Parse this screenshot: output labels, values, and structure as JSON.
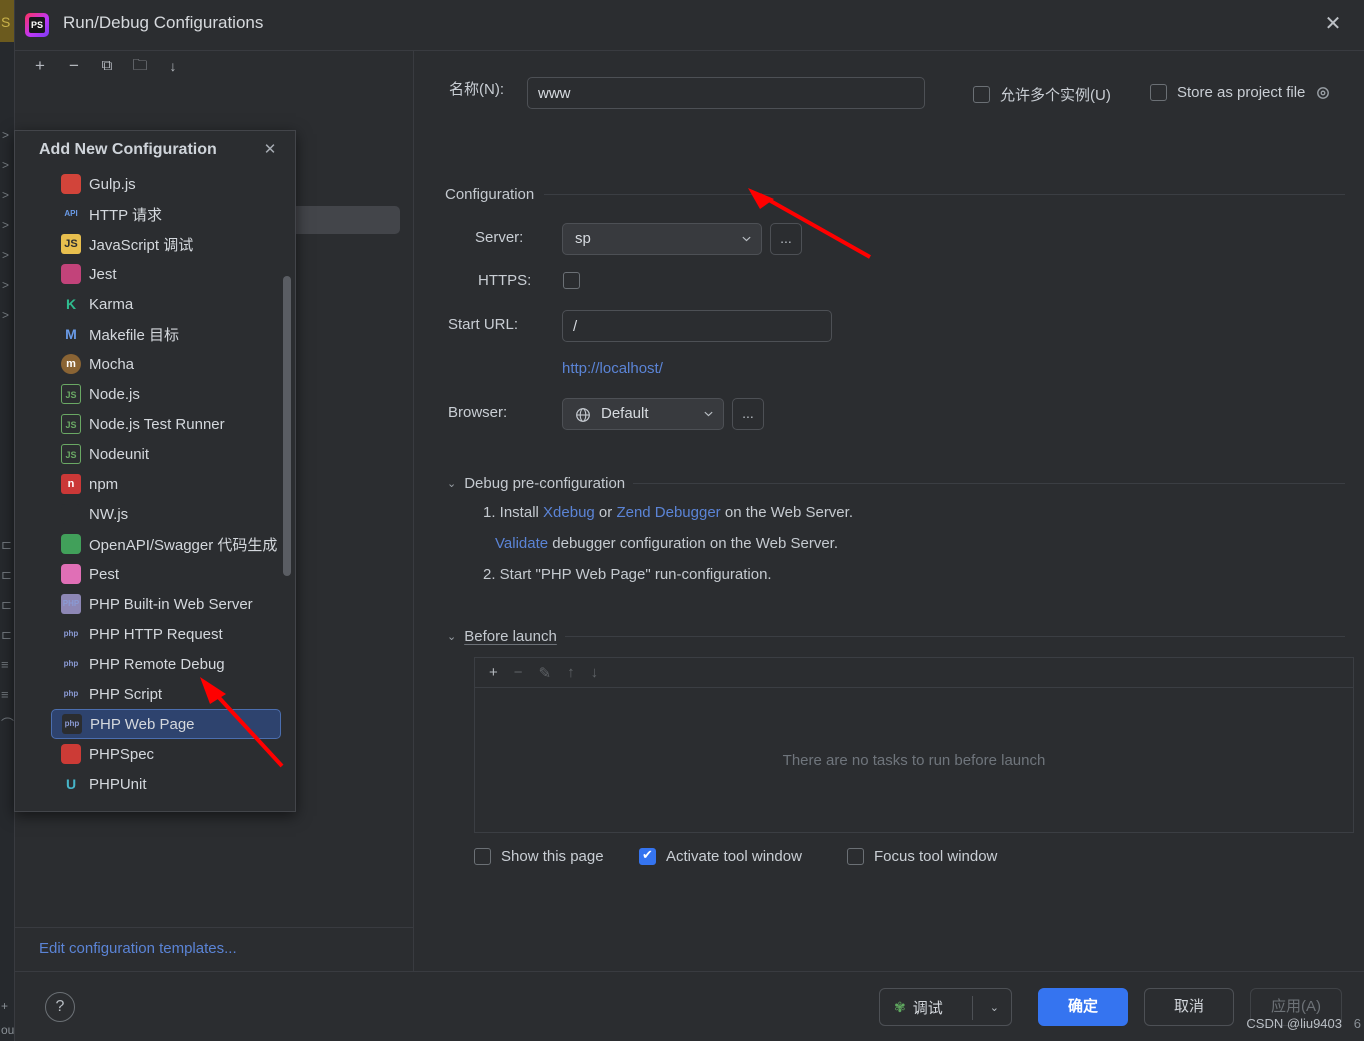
{
  "window": {
    "title": "Run/Debug Configurations",
    "app_icon": "phpstorm-icon",
    "close_label": "✕",
    "accent": "#3574f0"
  },
  "left_toolbar": {
    "add_label": "+",
    "remove_label": "−",
    "copy_label": "⧉",
    "folder_label": "🗀",
    "sort_label": "↓"
  },
  "popup": {
    "title": "Add New Configuration",
    "close_label": "✕",
    "items": [
      {
        "label": "Gulp.js",
        "icon": "gulp-icon",
        "glyph": "",
        "bg": "#d2443a",
        "selected": false
      },
      {
        "label": "HTTP 请求",
        "icon": "http-request-icon",
        "glyph": "API",
        "bg": "#2b2d30",
        "selected": false
      },
      {
        "label": "JavaScript 调试",
        "icon": "javascript-icon",
        "glyph": "JS",
        "bg": "#e8bf4e",
        "selected": false
      },
      {
        "label": "Jest",
        "icon": "jest-icon",
        "glyph": "",
        "bg": "#c2437a",
        "selected": false
      },
      {
        "label": "Karma",
        "icon": "karma-icon",
        "glyph": "K",
        "bg": "#2b2d30",
        "selected": false
      },
      {
        "label": "Makefile 目标",
        "icon": "makefile-icon",
        "glyph": "M",
        "bg": "#2b2d30",
        "selected": false
      },
      {
        "label": "Mocha",
        "icon": "mocha-icon",
        "glyph": "m",
        "bg": "#8a6434",
        "selected": false
      },
      {
        "label": "Node.js",
        "icon": "nodejs-icon",
        "glyph": "JS",
        "bg": "#2b2d30",
        "selected": false
      },
      {
        "label": "Node.js Test Runner",
        "icon": "nodejs-test-runner-icon",
        "glyph": "JS",
        "bg": "#2b2d30",
        "selected": false
      },
      {
        "label": "Nodeunit",
        "icon": "nodeunit-icon",
        "glyph": "JS",
        "bg": "#2b2d30",
        "selected": false
      },
      {
        "label": "npm",
        "icon": "npm-icon",
        "glyph": "n",
        "bg": "#cb3837",
        "selected": false
      },
      {
        "label": "NW.js",
        "icon": "nwjs-icon",
        "glyph": "",
        "bg": "#2b2d30",
        "selected": false
      },
      {
        "label": "OpenAPI/Swagger 代码生成",
        "icon": "openapi-swagger-icon",
        "glyph": "",
        "bg": "#41a05a",
        "selected": false
      },
      {
        "label": "Pest",
        "icon": "pest-icon",
        "glyph": "",
        "bg": "#e06fb6",
        "selected": false
      },
      {
        "label": "PHP Built-in Web Server",
        "icon": "php-builtin-server-icon",
        "glyph": "PHP",
        "bg": "#8d87b5",
        "selected": false
      },
      {
        "label": "PHP HTTP Request",
        "icon": "php-http-request-icon",
        "glyph": "php",
        "bg": "#2b2d30",
        "selected": false
      },
      {
        "label": "PHP Remote Debug",
        "icon": "php-remote-debug-icon",
        "glyph": "php",
        "bg": "#2b2d30",
        "selected": false
      },
      {
        "label": "PHP Script",
        "icon": "php-script-icon",
        "glyph": "php",
        "bg": "#2b2d30",
        "selected": false
      },
      {
        "label": "PHP Web Page",
        "icon": "php-web-page-icon",
        "glyph": "php",
        "bg": "#2b2d30",
        "selected": true
      },
      {
        "label": "PHPSpec",
        "icon": "phpspec-icon",
        "glyph": "",
        "bg": "#cc3b36",
        "selected": false
      },
      {
        "label": "PHPUnit",
        "icon": "phpunit-icon",
        "glyph": "U",
        "bg": "#2b2d30",
        "selected": false
      }
    ]
  },
  "left_footer": {
    "edit_templates_label": "Edit configuration templates..."
  },
  "form": {
    "name_label": "名称(N):",
    "name_value": "www",
    "name_placeholder": "",
    "allow_multiple_label": "允许多个实例(U)",
    "allow_multiple_checked": false,
    "store_as_project_file_label": "Store as project file",
    "store_as_project_file_checked": false,
    "gear_icon": "gear-icon",
    "configuration_group_label": "Configuration",
    "server_label": "Server:",
    "server_value": "sp",
    "server_dots_label": "...",
    "https_label": "HTTPS:",
    "https_checked": false,
    "start_url_label": "Start URL:",
    "start_url_value": "/",
    "resolved_url": "http://localhost/",
    "browser_label": "Browser:",
    "browser_value": "Default",
    "browser_icon": "globe-icon",
    "browser_dots_label": "..."
  },
  "debug_pre": {
    "group_label": "Debug pre-configuration",
    "step1_prefix": "1. Install ",
    "step1_link1": "Xdebug",
    "step1_mid": " or ",
    "step1_link2": "Zend Debugger",
    "step1_suffix": " on the Web Server.",
    "step1b_link": "Validate",
    "step1b_suffix": " debugger configuration on the Web Server.",
    "step2": "2. Start \"PHP Web Page\" run-configuration."
  },
  "before_launch": {
    "group_label": "Before launch",
    "toolbar": {
      "add": "+",
      "remove": "−",
      "edit": "✎",
      "up": "↑",
      "down": "↓"
    },
    "empty_text": "There are no tasks to run before launch",
    "checkboxes": [
      {
        "label": "Show this page",
        "checked": false,
        "name": "show-this-page-checkbox"
      },
      {
        "label": "Activate tool window",
        "checked": true,
        "name": "activate-tool-window-checkbox"
      },
      {
        "label": "Focus tool window",
        "checked": false,
        "name": "focus-tool-window-checkbox"
      }
    ]
  },
  "footer": {
    "help_label": "?",
    "debug_label": "调试",
    "debug_icon": "bug-icon",
    "ok_label": "确定",
    "cancel_label": "取消",
    "apply_label": "应用(A)",
    "watermark": "CSDN @liu9403",
    "watermark_tail": "6"
  }
}
